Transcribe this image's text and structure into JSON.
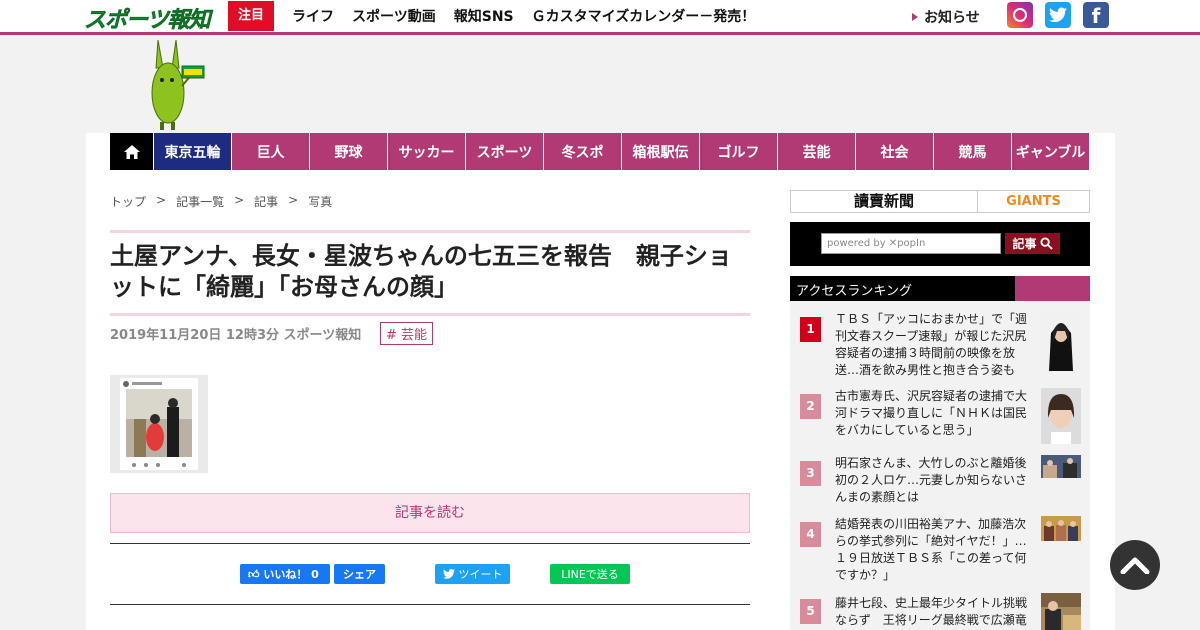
{
  "header": {
    "logo_text": "スポーツ報知",
    "attention_label": "注目",
    "nav": [
      "ライフ",
      "スポーツ動画",
      "報知SNS",
      "Ｇカスタマイズカレンダー－発売！"
    ],
    "notice_label": "お知らせ"
  },
  "category_nav": [
    "東京五輪",
    "巨人",
    "野球",
    "サッカー",
    "スポーツ",
    "冬スポ",
    "箱根駅伝",
    "ゴルフ",
    "芸能",
    "社会",
    "競馬",
    "ギャンブル"
  ],
  "breadcrumb": [
    "トップ",
    "記事一覧",
    "記事",
    "写真"
  ],
  "breadcrumb_sep": ">",
  "article": {
    "title": "土屋アンナ、長女・星波ちゃんの七五三を報告　親子ショットに「綺麗」「お母さんの顔」",
    "meta": "2019年11月20日 12時3分  スポーツ報知",
    "tag": "# 芸能",
    "read_more": "記事を読む"
  },
  "share": {
    "like": "いいね！ 0",
    "share": "シェア",
    "tweet": "ツイート",
    "line": "LINEで送る"
  },
  "sidebar": {
    "banner_yomiuri": "讀賣新聞",
    "banner_giants": "GIANTS",
    "search_placeholder": "powered by ✕popIn",
    "search_button": "記事",
    "ranking_title": "アクセスランキング",
    "ranking": [
      {
        "rank": "1",
        "text": "ＴＢＳ「アッコにおまかせ」で「週刊文春スクープ速報」が報じた沢尻容疑者の逮捕３時間前の映像を放送…酒を飲み男性と抱き合う姿も"
      },
      {
        "rank": "2",
        "text": "古市憲寿氏、沢尻容疑者の逮捕で大河ドラマ撮り直しに「ＮＨＫは国民をバカにしていると思う」"
      },
      {
        "rank": "3",
        "text": "明石家さんま、大竹しのぶと離婚後初の２人ロケ…元妻しか知らないさんまの素顔とは"
      },
      {
        "rank": "4",
        "text": "結婚発表の川田裕美アナ、加藤浩次らの挙式参列に「絶対イヤだ！」…１９日放送ＴＢＳ系「この差って何ですか？」"
      },
      {
        "rank": "5",
        "text": "藤井七段、史上最年少タイトル挑戦ならず　王将リーグ最終戦で広瀬竜"
      }
    ]
  },
  "colors": {
    "brand": "#b23a74",
    "olympic": "#1d2b80",
    "attention": "#e00d26",
    "rank_top": "#d0021b",
    "rank_other": "#d98b9b"
  }
}
